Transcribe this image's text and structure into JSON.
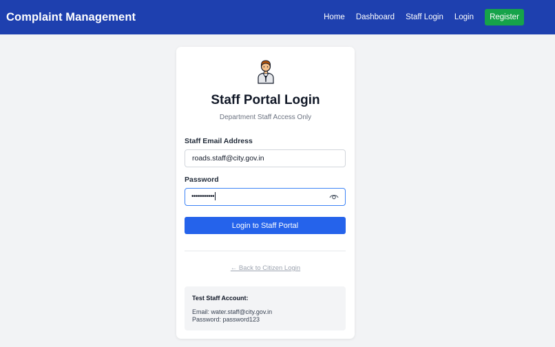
{
  "navbar": {
    "brand": "Complaint Management",
    "links": [
      "Home",
      "Dashboard",
      "Staff Login",
      "Login"
    ],
    "register_label": "Register"
  },
  "card": {
    "icon": "staff-person-icon",
    "title": "Staff Portal Login",
    "subtitle": "Department Staff Access Only",
    "email_label": "Staff Email Address",
    "email_value": "roads.staff@city.gov.in",
    "password_label": "Password",
    "password_masked": "•••••••••••",
    "submit_label": "Login to Staff Portal",
    "back_link": "← Back to Citizen Login"
  },
  "test_account": {
    "title": "Test Staff Account:",
    "email_line": "Email: water.staff@city.gov.in",
    "password_line": "Password: password123"
  },
  "colors": {
    "navbar_bg": "#1e40af",
    "register_bg": "#16a34a",
    "primary_button": "#2563eb",
    "focus_border": "#3b82f6"
  }
}
